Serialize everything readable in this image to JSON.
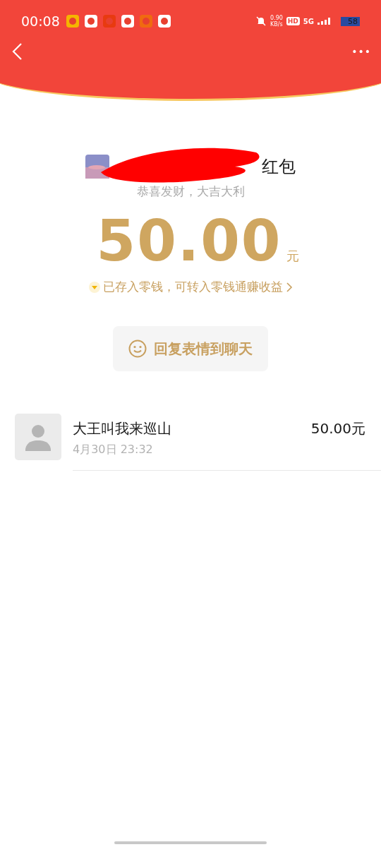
{
  "status_bar": {
    "time": "00:08",
    "net_speed": "0.90",
    "net_unit": "KB/s",
    "hd": "HD",
    "network": "5G",
    "battery": "58"
  },
  "header": {
    "more": "•••"
  },
  "envelope": {
    "title": "红包",
    "blessing": "恭喜发财，大吉大利",
    "amount": "50.00",
    "currency": "元",
    "notice": "已存入零钱，可转入零钱通赚收益"
  },
  "reply_button": {
    "label": "回复表情到聊天"
  },
  "records": [
    {
      "name": "大王叫我来巡山",
      "time": "4月30日  23:32",
      "amount": "50.00元"
    }
  ]
}
